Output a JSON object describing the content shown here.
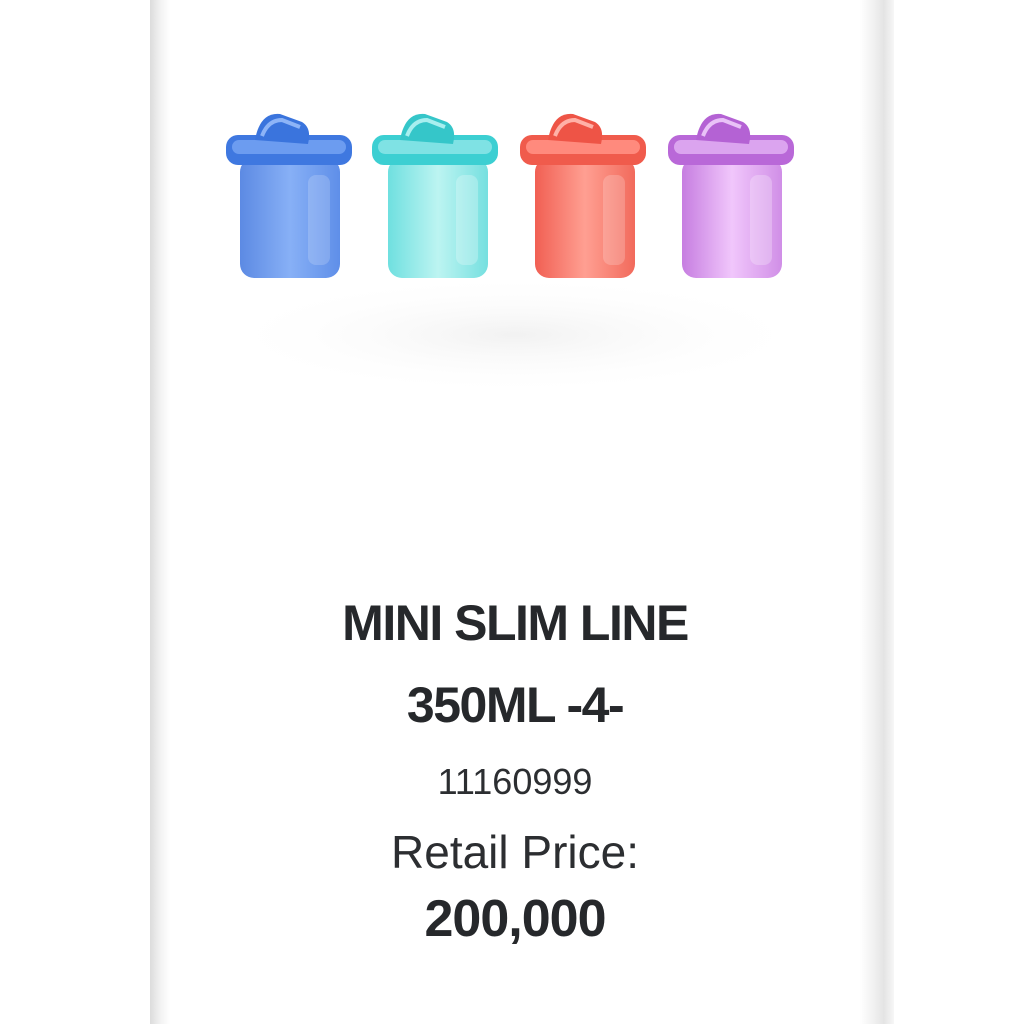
{
  "product": {
    "title_line1": "MINI SLIM LINE",
    "title_line2": "350ML -4-",
    "sku": "11160999",
    "price_label": "Retail Price:",
    "price_value": "200,000"
  },
  "image": {
    "containers": [
      {
        "color_name": "blue",
        "color": "#5b8fe8"
      },
      {
        "color_name": "aqua",
        "color": "#52d2d3"
      },
      {
        "color_name": "coral",
        "color": "#f26a5c"
      },
      {
        "color_name": "purple",
        "color": "#c97be0"
      }
    ]
  }
}
